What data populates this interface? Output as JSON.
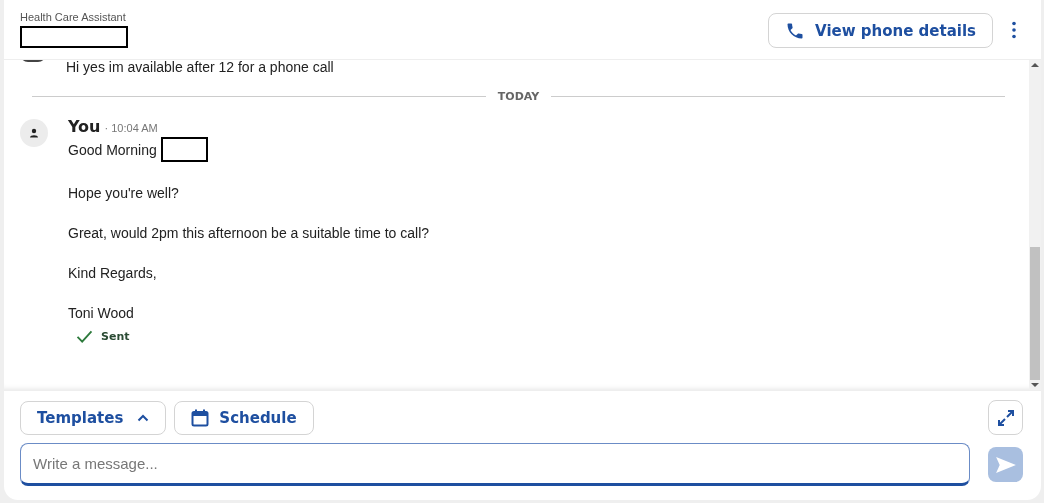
{
  "header": {
    "subtitle": "Health Care Assistant",
    "phone_button": "View phone details"
  },
  "messages": [
    {
      "kind": "incoming",
      "lines": [
        "Hi yes im available after 12 for a phone call"
      ]
    },
    {
      "kind": "divider",
      "label": "TODAY"
    },
    {
      "kind": "outgoing",
      "sender": "You",
      "time": "· 10:04 AM",
      "lines": [
        "Good Morning",
        "Hope you're well?",
        "Great, would 2pm this afternoon be a suitable time to call?",
        "Kind Regards,",
        "Toni Wood"
      ],
      "status": "Sent"
    }
  ],
  "composer": {
    "templates_button": "Templates",
    "templates_expanded": true,
    "schedule_button": "Schedule",
    "placeholder": "Write a message...",
    "send_disabled": true
  }
}
